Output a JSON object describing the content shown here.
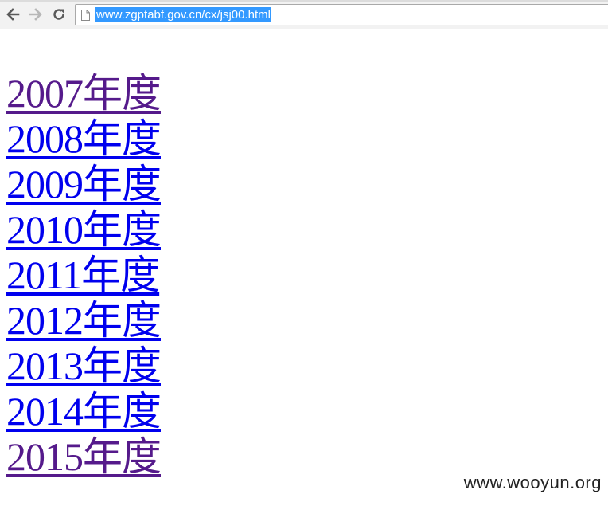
{
  "browser": {
    "address_bar": {
      "url": "www.zgptabf.gov.cn/cx/jsj00.html"
    },
    "icons": {
      "back": "arrow-left-icon",
      "forward": "arrow-right-icon",
      "reload": "reload-icon",
      "page": "page-icon"
    },
    "colors": {
      "url_selection": "#3399ff",
      "visited_link": "#551a8b",
      "unvisited_link": "#0000ee"
    }
  },
  "page": {
    "links": [
      {
        "label": "2007年度",
        "visited": true
      },
      {
        "label": "2008年度",
        "visited": false
      },
      {
        "label": "2009年度",
        "visited": false
      },
      {
        "label": "2010年度",
        "visited": false
      },
      {
        "label": "2011年度",
        "visited": false
      },
      {
        "label": "2012年度",
        "visited": false
      },
      {
        "label": "2013年度",
        "visited": false
      },
      {
        "label": "2014年度",
        "visited": false
      },
      {
        "label": "2015年度",
        "visited": true
      }
    ]
  },
  "watermark": "www.wooyun.org"
}
